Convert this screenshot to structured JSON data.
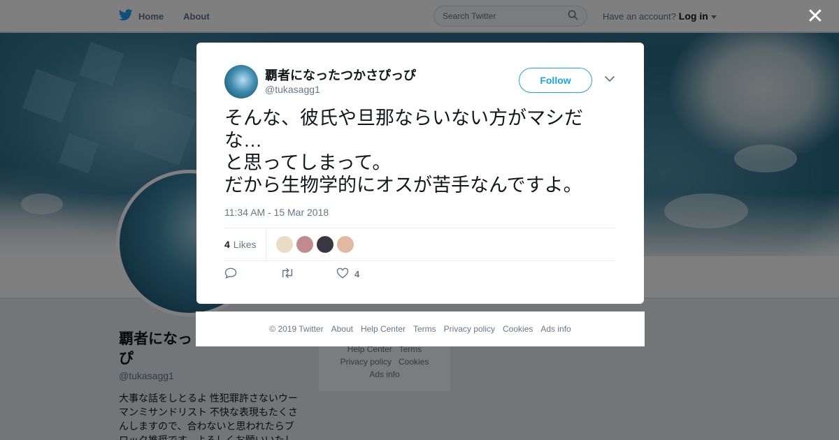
{
  "nav": {
    "home_label": "Home",
    "about_label": "About",
    "search_placeholder": "Search Twitter",
    "account_prompt": "Have an account?",
    "login_label": "Log in"
  },
  "profile": {
    "name": "覇者になったつかさぴっぴ",
    "name_line1": "覇者になっ",
    "name_line2": "ぴ",
    "handle": "@tukasagg1",
    "bio": "大事な話をしとるよ 性犯罪許さないウーマンミサンドリスト 不快な表現もたくさんしますので、合わないと思われたらブロック推奨です。よろしくお願いいたし",
    "side_links": [
      "Help Center",
      "Terms",
      "Privacy policy",
      "Cookies",
      "Ads info"
    ]
  },
  "tweet": {
    "author_name": "覇者になったつかさぴっぴ",
    "author_handle": "@tukasagg1",
    "follow_label": "Follow",
    "text": "そんな、彼氏や旦那ならいない方がマシだな…\nと思ってしまって。\nだから生物学的にオスが苦手なんですよ。",
    "timestamp": "11:34 AM - 15 Mar 2018",
    "likes_count": "4",
    "likes_label": "Likes",
    "like_action_count": "4",
    "liker_colors": [
      "#e9dcc7",
      "#c08a8e",
      "#3a3540",
      "#e3b8a0"
    ]
  },
  "footer": {
    "links": [
      "© 2019 Twitter",
      "About",
      "Help Center",
      "Terms",
      "Privacy policy",
      "Cookies",
      "Ads info"
    ]
  },
  "icons": {
    "brand": "twitter-bird-icon",
    "search": "search-icon",
    "close": "close-icon",
    "chevron": "chevron-down-icon",
    "reply": "reply-icon",
    "retweet": "retweet-icon",
    "like": "heart-icon"
  },
  "colors": {
    "brand_blue": "#1da1f2",
    "muted_text": "#657786"
  }
}
